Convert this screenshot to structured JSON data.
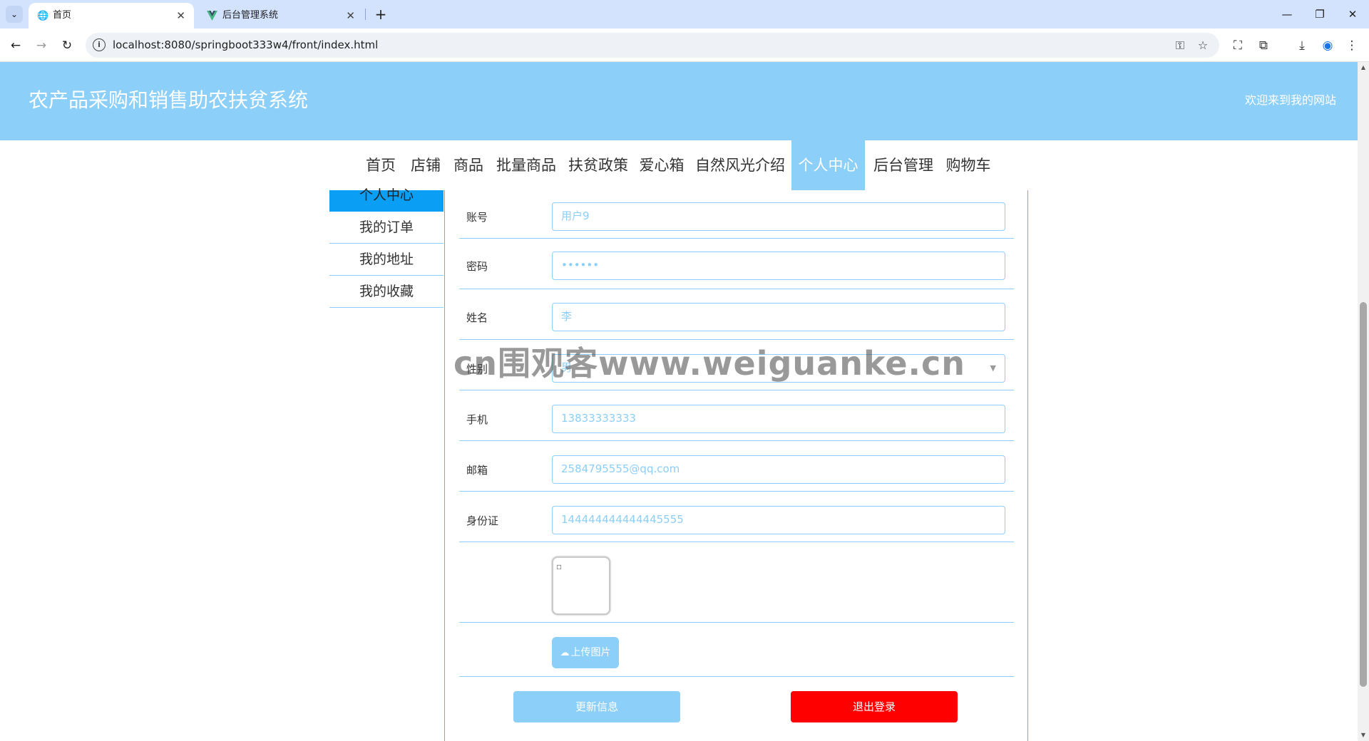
{
  "browser": {
    "tabs": [
      {
        "label": "首页",
        "icon": "globe-icon",
        "active": true
      },
      {
        "label": "后台管理系统",
        "icon": "vue-logo-icon",
        "active": false
      }
    ],
    "tab_search_glyph": "⌄",
    "new_tab_glyph": "+",
    "close_glyph": "✕",
    "window_controls": {
      "minimize": "—",
      "restore": "❐",
      "close": "✕"
    },
    "url": "localhost:8080/springboot333w4/front/index.html",
    "nav_glyphs": {
      "back": "←",
      "forward": "→",
      "reload": "↻"
    },
    "toolbar_glyphs": {
      "password": "⚿",
      "bookmark": "☆",
      "screenshot": "⛶",
      "extensions": "⧉",
      "download": "⤓",
      "profile": "◉",
      "menu": "⋮"
    }
  },
  "site": {
    "title": "农产品采购和销售助农扶贫系统",
    "welcome": "欢迎来到我的网站",
    "banner_color": "#8ccff8"
  },
  "nav": {
    "items": [
      {
        "label": "首页"
      },
      {
        "label": "店铺"
      },
      {
        "label": "商品"
      },
      {
        "label": "批量商品"
      },
      {
        "label": "扶贫政策"
      },
      {
        "label": "爱心箱"
      },
      {
        "label": "自然风光介绍"
      },
      {
        "label": "个人中心",
        "active": true
      },
      {
        "label": "后台管理"
      },
      {
        "label": "购物车"
      }
    ]
  },
  "sidebar": {
    "items": [
      {
        "label": "个人中心",
        "active": true
      },
      {
        "label": "我的订单"
      },
      {
        "label": "我的地址"
      },
      {
        "label": "我的收藏"
      }
    ],
    "active_color": "#0a9ff5"
  },
  "form": {
    "fields": [
      {
        "label": "账号",
        "value": "用户9"
      },
      {
        "label": "密码",
        "value": "••••••"
      },
      {
        "label": "姓名",
        "value": "李"
      },
      {
        "label": "性别",
        "value": "男"
      },
      {
        "label": "手机",
        "value": "13833333333"
      },
      {
        "label": "邮箱",
        "value": "2584795555@qq.com"
      },
      {
        "label": "身份证",
        "value": "144444444444445555"
      }
    ],
    "select_caret": "▼",
    "avatar_broken_glyph": "▫",
    "upload_label": "上传图片",
    "upload_glyph": "☁",
    "update_label": "更新信息",
    "logout_label": "退出登录",
    "logout_color": "#ff0000"
  },
  "watermark": "cn围观客www.weiguanke.cn",
  "scroll_glyphs": {
    "up": "▲",
    "down": "▼"
  }
}
